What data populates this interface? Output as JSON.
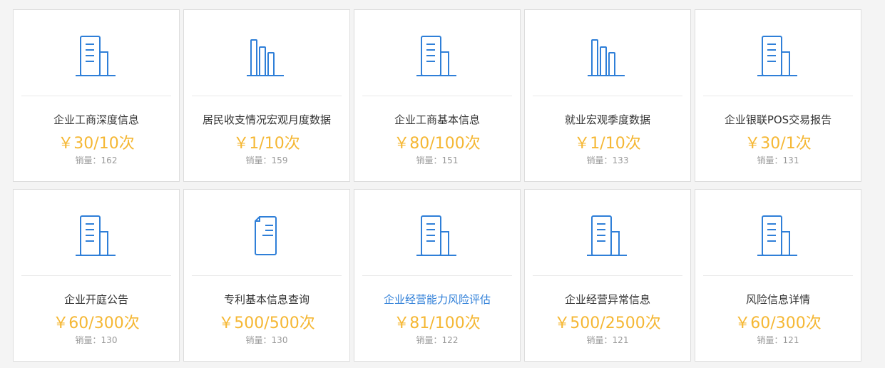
{
  "colors": {
    "accent": "#2f7fd8",
    "price": "#f5b733"
  },
  "sales_label": "销量：",
  "products": [
    {
      "icon": "building",
      "title": "企业工商深度信息",
      "price": "￥30/10次",
      "sales": "162"
    },
    {
      "icon": "bar-chart",
      "title": "居民收支情况宏观月度数据",
      "price": "￥1/10次",
      "sales": "159"
    },
    {
      "icon": "building",
      "title": "企业工商基本信息",
      "price": "￥80/100次",
      "sales": "151"
    },
    {
      "icon": "bar-chart",
      "title": "就业宏观季度数据",
      "price": "￥1/10次",
      "sales": "133"
    },
    {
      "icon": "building",
      "title": "企业银联POS交易报告",
      "price": "￥30/1次",
      "sales": "131"
    },
    {
      "icon": "building",
      "title": "企业开庭公告",
      "price": "￥60/300次",
      "sales": "130"
    },
    {
      "icon": "document",
      "title": "专利基本信息查询",
      "price": "￥500/500次",
      "sales": "130"
    },
    {
      "icon": "building",
      "title": "企业经营能力风险评估",
      "price": "￥81/100次",
      "sales": "122",
      "active": true
    },
    {
      "icon": "building",
      "title": "企业经营异常信息",
      "price": "￥500/2500次",
      "sales": "121"
    },
    {
      "icon": "building",
      "title": "风险信息详情",
      "price": "￥60/300次",
      "sales": "121"
    }
  ]
}
